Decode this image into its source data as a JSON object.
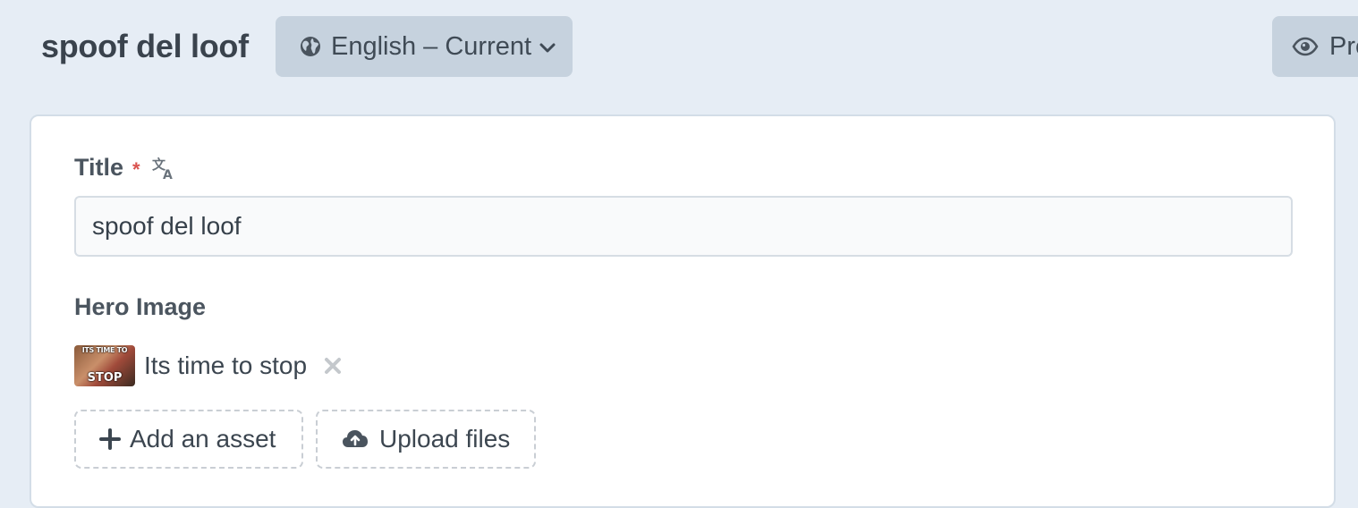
{
  "header": {
    "title": "spoof del loof",
    "locale_label": "English – Current",
    "preview_label": "Preview"
  },
  "form": {
    "title_field": {
      "label": "Title",
      "required_mark": "*",
      "value": "spoof del loof"
    },
    "hero_image": {
      "label": "Hero Image",
      "asset": {
        "name": "Its time to stop",
        "thumb_top_text": "ITS TIME TO",
        "thumb_bottom_text": "STOP"
      },
      "add_asset_label": "Add an asset",
      "upload_files_label": "Upload files"
    }
  },
  "icons": {
    "globe": "globe-icon",
    "chevron": "chevron-down-icon",
    "eye": "eye-icon",
    "translate": "translate-icon",
    "remove": "close-icon",
    "plus": "plus-icon",
    "upload": "cloud-upload-icon"
  },
  "colors": {
    "background": "#e6edf5",
    "button_bg": "#c6d2de",
    "required": "#d9534f"
  }
}
